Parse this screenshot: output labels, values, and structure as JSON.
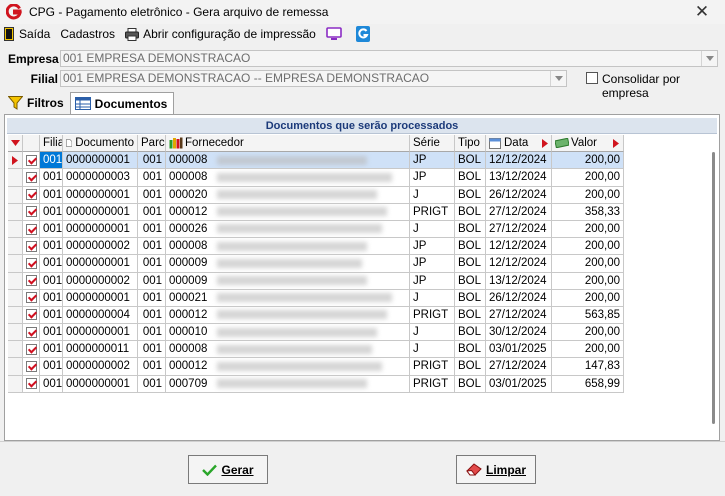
{
  "window": {
    "title": "CPG - Pagamento eletrônico - Gera arquivo de remessa",
    "close_glyph": "✕"
  },
  "menu": {
    "exit": "Saída",
    "registers": "Cadastros",
    "print_config": "Abrir configuração de impressão"
  },
  "form": {
    "empresa_label": "Empresa",
    "empresa_value": "001 EMPRESA DEMONSTRACAO",
    "filial_label": "Filial",
    "filial_value": "001 EMPRESA DEMONSTRACAO -- EMPRESA DEMONSTRACAO",
    "consolidate_label": "Consolidar por empresa",
    "consolidate_checked": false
  },
  "tabs": {
    "filters": "Filtros",
    "documents": "Documentos",
    "active": "documents"
  },
  "grid": {
    "title": "Documentos que serão processados",
    "columns": {
      "filial": "Filial",
      "documento": "Documento",
      "parcela": "Parc.",
      "fornecedor": "Fornecedor",
      "serie": "Série",
      "tipo": "Tipo",
      "data": "Data",
      "valor": "Valor"
    },
    "rows": [
      {
        "filial": "001",
        "documento": "0000000001",
        "parcela": "001",
        "fornecedor": "000008",
        "serie": "JP",
        "tipo": "BOL",
        "data": "12/12/2024",
        "valor": "200,00",
        "checked": true,
        "selected": true
      },
      {
        "filial": "001",
        "documento": "0000000003",
        "parcela": "001",
        "fornecedor": "000008",
        "serie": "JP",
        "tipo": "BOL",
        "data": "13/12/2024",
        "valor": "200,00",
        "checked": true,
        "selected": false
      },
      {
        "filial": "001",
        "documento": "0000000001",
        "parcela": "001",
        "fornecedor": "000020",
        "serie": "J",
        "tipo": "BOL",
        "data": "26/12/2024",
        "valor": "200,00",
        "checked": true,
        "selected": false
      },
      {
        "filial": "001",
        "documento": "0000000001",
        "parcela": "001",
        "fornecedor": "000012",
        "serie": "PRIGT",
        "tipo": "BOL",
        "data": "27/12/2024",
        "valor": "358,33",
        "checked": true,
        "selected": false
      },
      {
        "filial": "001",
        "documento": "0000000001",
        "parcela": "001",
        "fornecedor": "000026",
        "serie": "J",
        "tipo": "BOL",
        "data": "27/12/2024",
        "valor": "200,00",
        "checked": true,
        "selected": false
      },
      {
        "filial": "001",
        "documento": "0000000002",
        "parcela": "001",
        "fornecedor": "000008",
        "serie": "JP",
        "tipo": "BOL",
        "data": "12/12/2024",
        "valor": "200,00",
        "checked": true,
        "selected": false
      },
      {
        "filial": "001",
        "documento": "0000000001",
        "parcela": "001",
        "fornecedor": "000009",
        "serie": "JP",
        "tipo": "BOL",
        "data": "12/12/2024",
        "valor": "200,00",
        "checked": true,
        "selected": false
      },
      {
        "filial": "001",
        "documento": "0000000002",
        "parcela": "001",
        "fornecedor": "000009",
        "serie": "JP",
        "tipo": "BOL",
        "data": "13/12/2024",
        "valor": "200,00",
        "checked": true,
        "selected": false
      },
      {
        "filial": "001",
        "documento": "0000000001",
        "parcela": "001",
        "fornecedor": "000021",
        "serie": "J",
        "tipo": "BOL",
        "data": "26/12/2024",
        "valor": "200,00",
        "checked": true,
        "selected": false
      },
      {
        "filial": "001",
        "documento": "0000000004",
        "parcela": "001",
        "fornecedor": "000012",
        "serie": "PRIGT",
        "tipo": "BOL",
        "data": "27/12/2024",
        "valor": "563,85",
        "checked": true,
        "selected": false
      },
      {
        "filial": "001",
        "documento": "0000000001",
        "parcela": "001",
        "fornecedor": "000010",
        "serie": "J",
        "tipo": "BOL",
        "data": "30/12/2024",
        "valor": "200,00",
        "checked": true,
        "selected": false
      },
      {
        "filial": "001",
        "documento": "0000000011",
        "parcela": "001",
        "fornecedor": "000008",
        "serie": "J",
        "tipo": "BOL",
        "data": "03/01/2025",
        "valor": "200,00",
        "checked": true,
        "selected": false
      },
      {
        "filial": "001",
        "documento": "0000000002",
        "parcela": "001",
        "fornecedor": "000012",
        "serie": "PRIGT",
        "tipo": "BOL",
        "data": "27/12/2024",
        "valor": "147,83",
        "checked": true,
        "selected": false
      },
      {
        "filial": "001",
        "documento": "0000000001",
        "parcela": "001",
        "fornecedor": "000709",
        "serie": "PRIGT",
        "tipo": "BOL",
        "data": "03/01/2025",
        "valor": "658,99",
        "checked": true,
        "selected": false
      }
    ]
  },
  "buttons": {
    "generate": "Gerar",
    "clear": "Limpar"
  },
  "colors": {
    "brand": "#d0141e",
    "selection": "#0078d7",
    "grid_title_text": "#1c3a7a"
  }
}
